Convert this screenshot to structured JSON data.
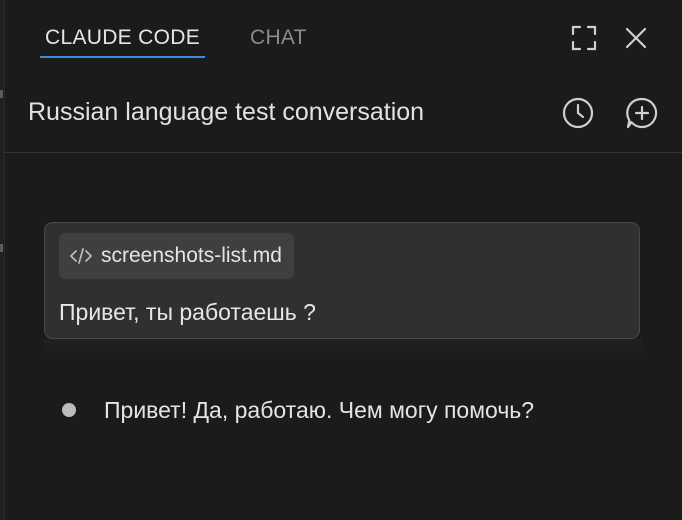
{
  "tabs": [
    {
      "label": "CLAUDE CODE",
      "active": true
    },
    {
      "label": "CHAT",
      "active": false
    }
  ],
  "window_controls": {
    "expand_icon": "expand-icon",
    "close_icon": "close-icon"
  },
  "conversation": {
    "title": "Russian language test conversation",
    "history_icon": "clock-history-icon",
    "new_chat_icon": "new-chat-plus-icon"
  },
  "user_message": {
    "attachment": {
      "icon": "code-icon",
      "label": "screenshots-list.md"
    },
    "text": "Привет, ты работаешь ?"
  },
  "assistant_message": {
    "text": "Привет! Да, работаю. Чем могу помочь?"
  },
  "colors": {
    "background": "#1b1b1c",
    "accent": "#3d8bd9",
    "card": "#303030",
    "chip": "#3f3f40"
  }
}
